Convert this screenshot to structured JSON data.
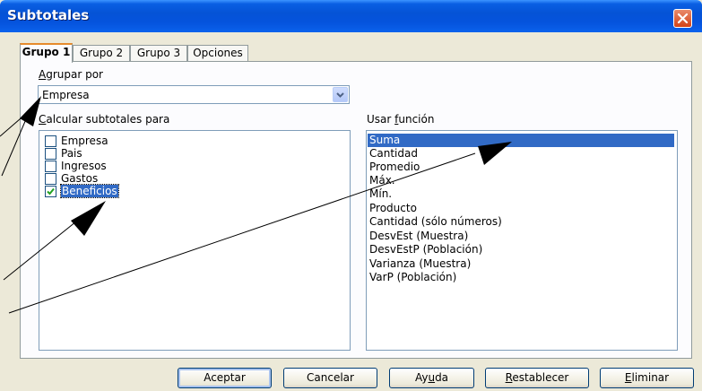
{
  "window": {
    "title": "Subtotales",
    "close_icon": "close-icon"
  },
  "tabs": [
    {
      "label": "Grupo 1",
      "active": true
    },
    {
      "label": "Grupo 2",
      "active": false
    },
    {
      "label": "Grupo 3",
      "active": false
    },
    {
      "label": "Opciones",
      "active": false
    }
  ],
  "group_by": {
    "label_u": "A",
    "label_rest": "grupar por",
    "value": "Empresa"
  },
  "calc_for": {
    "label_u": "C",
    "label_rest": "alcular subtotales para",
    "items": [
      {
        "label": "Empresa",
        "checked": false,
        "selected": false
      },
      {
        "label": "Pais",
        "checked": false,
        "selected": false
      },
      {
        "label": "Ingresos",
        "checked": false,
        "selected": false
      },
      {
        "label": "Gastos",
        "checked": false,
        "selected": false
      },
      {
        "label": "Beneficios",
        "checked": true,
        "selected": true
      }
    ]
  },
  "use_function": {
    "label_pre": "Usar ",
    "label_u": "f",
    "label_rest": "unción",
    "items": [
      {
        "label": "Suma",
        "selected": true
      },
      {
        "label": "Cantidad",
        "selected": false
      },
      {
        "label": "Promedio",
        "selected": false
      },
      {
        "label": "Máx.",
        "selected": false
      },
      {
        "label": "Mín.",
        "selected": false
      },
      {
        "label": "Producto",
        "selected": false
      },
      {
        "label": "Cantidad (sólo números)",
        "selected": false
      },
      {
        "label": "DesvEst (Muestra)",
        "selected": false
      },
      {
        "label": "DesvEstP (Población)",
        "selected": false
      },
      {
        "label": "Varianza (Muestra)",
        "selected": false
      },
      {
        "label": "VarP (Población)",
        "selected": false
      }
    ]
  },
  "buttons": {
    "ok": "Aceptar",
    "cancel": "Cancelar",
    "help_pre": "Ay",
    "help_u": "u",
    "help_rest": "da",
    "reset_u": "R",
    "reset_rest": "establecer",
    "delete_u": "E",
    "delete_rest": "liminar"
  },
  "colors": {
    "titlebar": "#0553d6",
    "selection": "#316ac5",
    "dialog_bg": "#ece9d8",
    "active_tab_accent": "#e68b2c"
  }
}
